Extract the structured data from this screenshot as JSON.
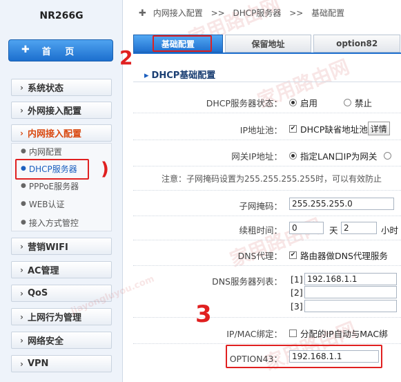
{
  "sidebar": {
    "model": "NR266G",
    "home_label": "首 页",
    "menu": [
      {
        "label": "系统状态"
      },
      {
        "label": "外网接入配置"
      },
      {
        "label": "内网接入配置"
      },
      {
        "label": "营销WIFI"
      },
      {
        "label": "AC管理"
      },
      {
        "label": "QoS"
      },
      {
        "label": "上网行为管理"
      },
      {
        "label": "网络安全"
      },
      {
        "label": "VPN"
      }
    ],
    "submenu": [
      {
        "label": "内网配置"
      },
      {
        "label": "DHCP服务器"
      },
      {
        "label": "PPPoE服务器"
      },
      {
        "label": "WEB认证"
      },
      {
        "label": "接入方式管控"
      }
    ]
  },
  "breadcrumb": {
    "items": [
      "内网接入配置",
      "DHCP服务器",
      "基础配置"
    ],
    "separator": ">>"
  },
  "tabs": [
    {
      "label": "基础配置"
    },
    {
      "label": "保留地址"
    },
    {
      "label": "option82"
    }
  ],
  "section_title": "DHCP基础配置",
  "form": {
    "dhcp_status": {
      "label": "DHCP服务器状态：",
      "opt_on": "启用",
      "opt_off": "禁止"
    },
    "ip_pool": {
      "label": "IP地址池：",
      "check_text": "DHCP缺省地址池",
      "button": "详情"
    },
    "gateway": {
      "label": "网关IP地址：",
      "radio_text": "指定LAN口IP为网关"
    },
    "note": "注意：子网掩码设置为255.255.255.255时，可以有效防止",
    "subnet": {
      "label": "子网掩码：",
      "value": "255.255.255.0"
    },
    "lease": {
      "label": "续租时间：",
      "days": "0",
      "days_unit": "天",
      "hours": "2",
      "hours_unit": "小时"
    },
    "dns_proxy": {
      "label": "DNS代理：",
      "check_text": "路由器做DNS代理服务"
    },
    "dns_list": {
      "label": "DNS服务器列表：",
      "idx1": "[1]",
      "val1": "192.168.1.1",
      "idx2": "[2]",
      "val2": "",
      "idx3": "[3]",
      "val3": ""
    },
    "ipmac": {
      "label": "IP/MAC绑定：",
      "check_text": "分配的IP自动与MAC绑"
    },
    "option43": {
      "label": "OPTION43：",
      "value": "192.168.1.1"
    }
  },
  "watermark": "家用路由网",
  "watermark_url": "jiayongluyou.com",
  "colors": {
    "accent": "#1f70cf",
    "active_menu": "#d9480f",
    "annotation": "#e02020"
  }
}
